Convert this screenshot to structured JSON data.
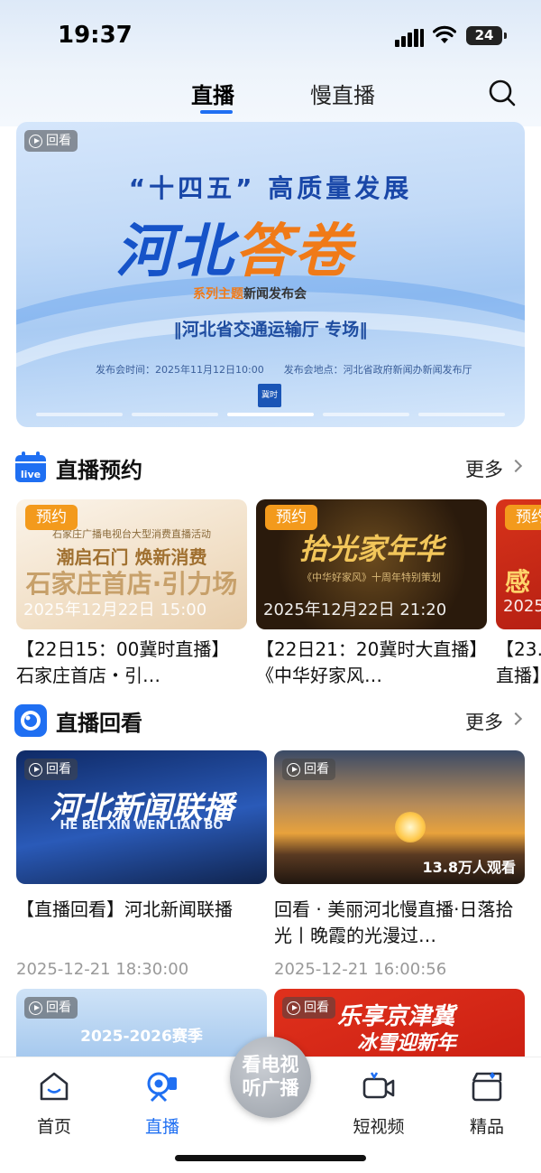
{
  "status": {
    "time": "19:37",
    "battery": "24"
  },
  "tabs": [
    {
      "label": "直播",
      "active": true
    },
    {
      "label": "慢直播",
      "active": false
    }
  ],
  "banner": {
    "tag": "回看",
    "headline": "“十四五” 高质量发展",
    "title_main": "河北",
    "title_accent": "答卷",
    "subtitle_accent": "系列主题",
    "subtitle": "新闻发布会",
    "dept": "‖河北省交通运输厅 专场‖",
    "info": "发布会时间：2025年11月12日10:00　　发布会地点：河北省政府新闻办新闻发布厅",
    "logo": "冀时",
    "active_slide": 3,
    "slides": 5
  },
  "reservation": {
    "title": "直播预约",
    "more": "更多",
    "cards": [
      {
        "badge": "预约",
        "date": "2025年12月22日 15:00",
        "line1": "石家庄广播电视台大型消费直播活动",
        "line2": "潮启石门 焕新消费",
        "line3": "石家庄首店·引力场",
        "text": "【22日15：00冀时直播】石家庄首店・引…"
      },
      {
        "badge": "预约",
        "date": "2025年12月22日 21:20",
        "line1": "《中华好家风》十周年特别策划",
        "line2": "",
        "line3": "拾光家年华",
        "text": "【22日21：20冀时大直播】《中华好家风…"
      },
      {
        "badge": "预约",
        "date": "2025",
        "line1": "",
        "line2": "",
        "line3": "感",
        "text": "【23…直播】"
      }
    ]
  },
  "replay": {
    "title": "直播回看",
    "more": "更多",
    "cards": [
      {
        "tag": "回看",
        "thumb_title": "河北新闻联播",
        "thumb_sub": "HE BEI XIN WEN LIAN BO",
        "title": "【直播回看】河北新闻联播",
        "date": "2025-12-21  18:30:00"
      },
      {
        "tag": "回看",
        "views": "13.8万人观看",
        "title": "回看 · 美丽河北慢直播·日落拾光丨晚霞的光漫过…",
        "date": "2025-12-21  16:00:56"
      },
      {
        "tag": "回看",
        "thumb_title": "2025-2026赛季"
      },
      {
        "tag": "回看",
        "thumb_title": "乐享京津冀",
        "thumb_sub": "冰雪迎新年"
      }
    ]
  },
  "center_button": {
    "line1": "看电视",
    "line2": "听广播"
  },
  "bottom_nav": [
    {
      "label": "首页",
      "active": false
    },
    {
      "label": "直播",
      "active": true
    },
    {
      "label": "短视频",
      "active": false
    },
    {
      "label": "精品",
      "active": false
    }
  ],
  "colors": {
    "accent": "#1f6ff2",
    "badge": "#f39a1c"
  }
}
